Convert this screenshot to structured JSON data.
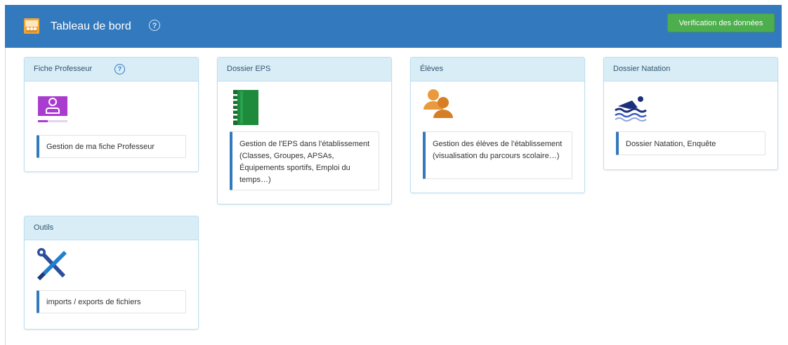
{
  "header": {
    "title": "Tableau de bord",
    "help_icon": "help-circle-icon",
    "verify_button": "Verification des données",
    "colors": {
      "bar": "#3379bd",
      "button": "#4cae4c"
    }
  },
  "cards": [
    {
      "title": "Fiche Professeur",
      "icon": "teacher-profile-icon",
      "description": "Gestion de ma fiche Professeur",
      "has_help": true
    },
    {
      "title": "Dossier EPS",
      "icon": "green-binder-icon",
      "description": "Gestion de l'EPS dans l'établissement (Classes, Groupes, APSAs, Équipements sportifs, Emploi du temps…)"
    },
    {
      "title": "Élèves",
      "icon": "students-icon",
      "description": "Gestion des élèves de l'établissement (visualisation du parcours scolaire…)"
    },
    {
      "title": "Dossier Natation",
      "icon": "swimmer-icon",
      "description": "Dossier Natation, Enquête"
    },
    {
      "title": "Outils",
      "icon": "tools-icon",
      "description": "imports / exports de fichiers"
    }
  ]
}
